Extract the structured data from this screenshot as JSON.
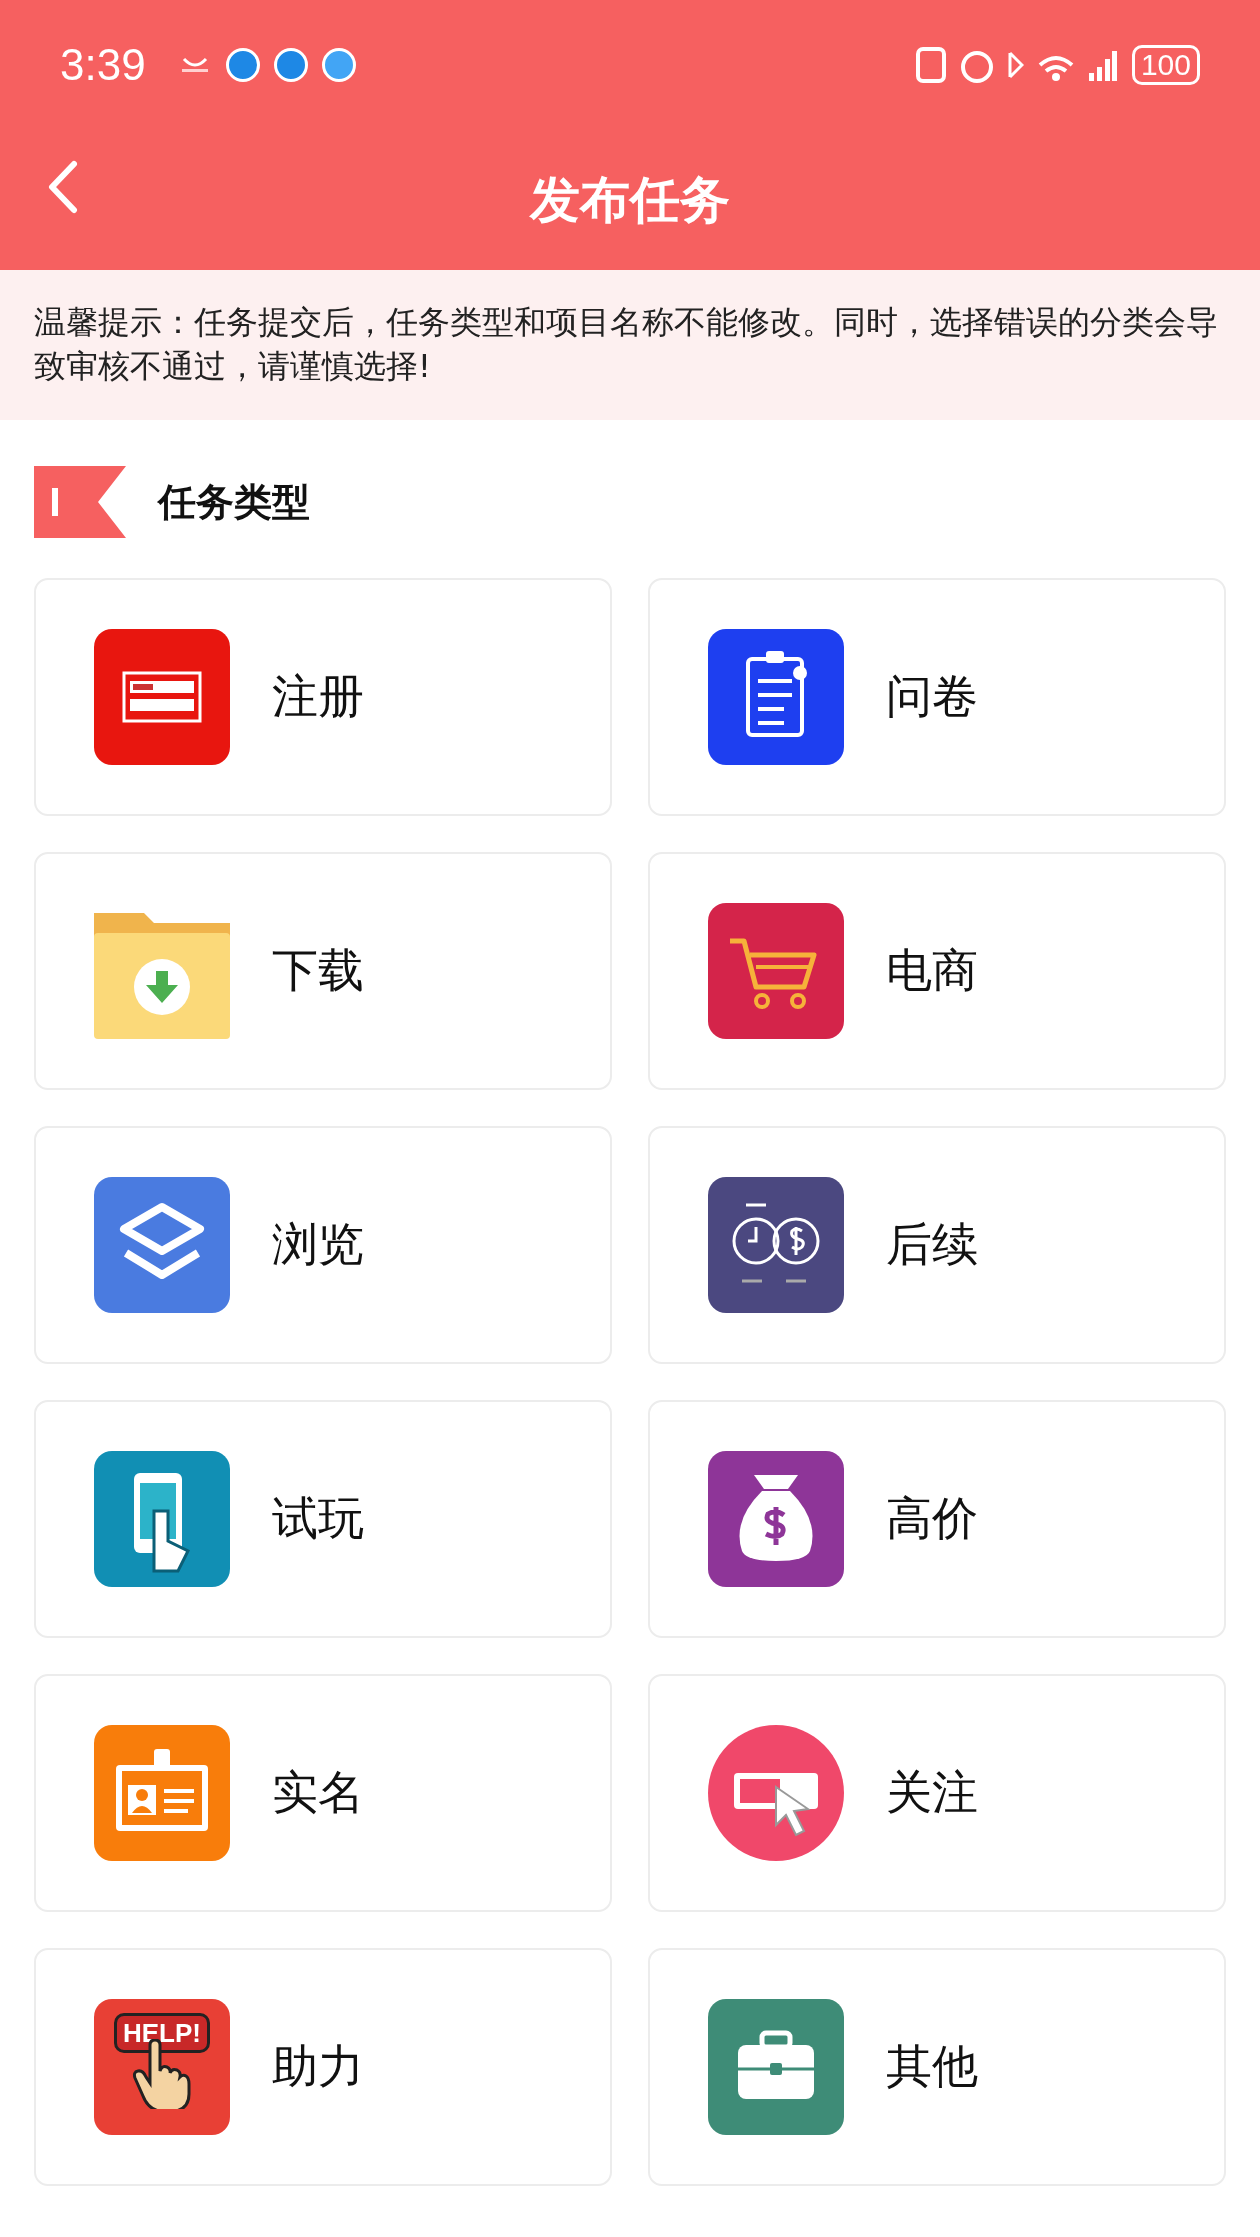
{
  "status_bar": {
    "time": "3:39",
    "battery": "100"
  },
  "header": {
    "title": "发布任务"
  },
  "notice": {
    "text": "温馨提示：任务提交后，任务类型和项目名称不能修改。同时，选择错误的分类会导致审核不通过，请谨慎选择!"
  },
  "section": {
    "title": "任务类型"
  },
  "task_types": [
    {
      "label": "注册",
      "kind": "register"
    },
    {
      "label": "问卷",
      "kind": "survey"
    },
    {
      "label": "下载",
      "kind": "download"
    },
    {
      "label": "电商",
      "kind": "shop"
    },
    {
      "label": "浏览",
      "kind": "browse"
    },
    {
      "label": "后续",
      "kind": "followup"
    },
    {
      "label": "试玩",
      "kind": "trial"
    },
    {
      "label": "高价",
      "kind": "highprice"
    },
    {
      "label": "实名",
      "kind": "realname"
    },
    {
      "label": "关注",
      "kind": "follow"
    },
    {
      "label": "助力",
      "kind": "help",
      "icon_text": "HELP!"
    },
    {
      "label": "其他",
      "kind": "other"
    }
  ]
}
